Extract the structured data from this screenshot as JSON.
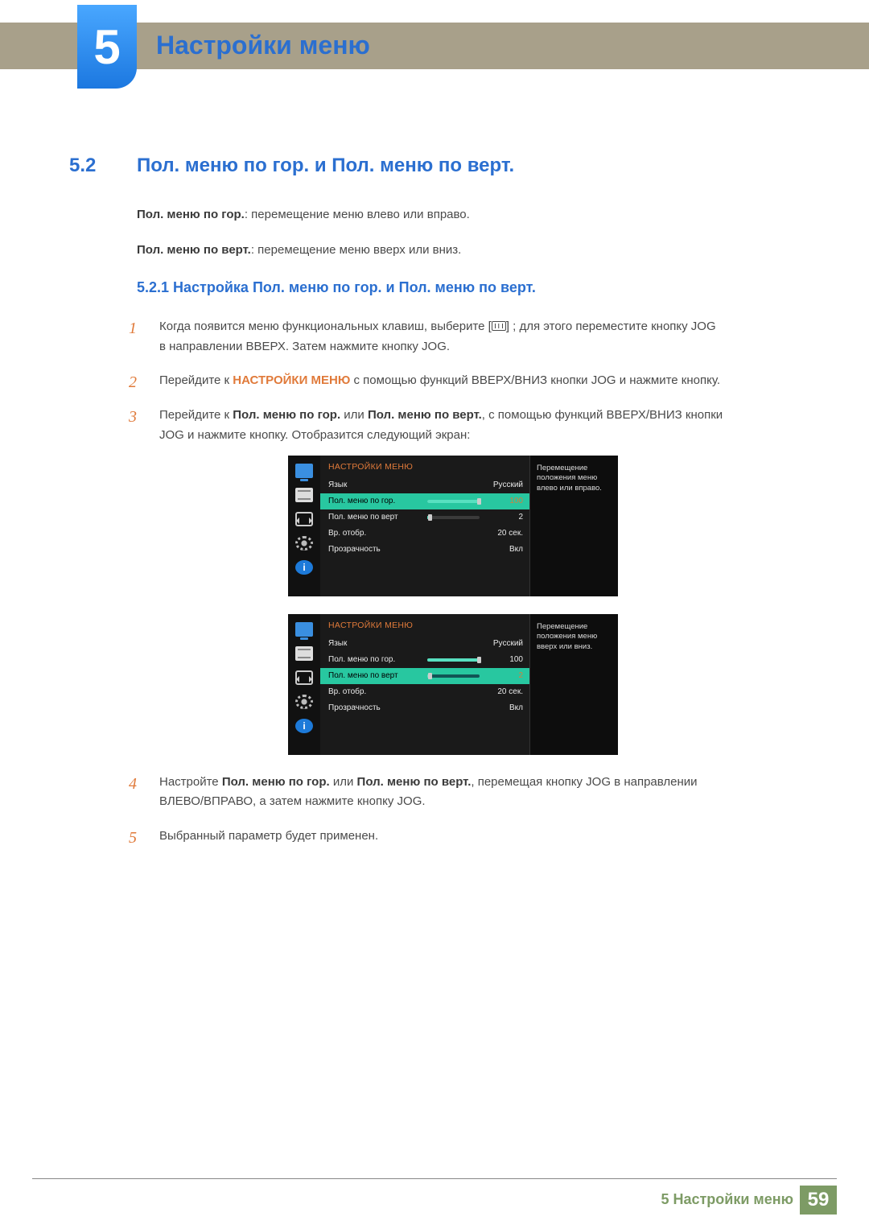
{
  "chapter": {
    "number": "5",
    "title": "Настройки меню"
  },
  "section": {
    "number": "5.2",
    "title": "Пол. меню по гор. и Пол. меню по верт."
  },
  "intro": {
    "l1_bold": "Пол. меню по гор.",
    "l1_rest": ": перемещение меню влево или вправо.",
    "l2_bold": "Пол. меню по верт.",
    "l2_rest": ": перемещение меню вверх или вниз."
  },
  "subheader": "5.2.1  Настройка Пол. меню по гор. и Пол. меню по верт.",
  "steps": {
    "s1a": "Когда появится меню функциональных клавиш, выберите [",
    "s1b": "] ; для этого переместите кнопку JOG в направлении ВВЕРХ. Затем нажмите кнопку JOG.",
    "s2a": "Перейдите к ",
    "s2b": "НАСТРОЙКИ МЕНЮ",
    "s2c": " с помощью функций ВВЕРХ/ВНИЗ кнопки JOG и нажмите кнопку.",
    "s3a": "Перейдите к ",
    "s3b": "Пол. меню по гор.",
    "s3c": " или ",
    "s3d": "Пол. меню по верт.",
    "s3e": ", с помощью функций ВВЕРХ/ВНИЗ кнопки JOG и нажмите кнопку. Отобразится следующий экран:",
    "s4a": "Настройте ",
    "s4b": "Пол. меню по гор.",
    "s4c": " или ",
    "s4d": "Пол. меню по верт.",
    "s4e": ", перемещая кнопку JOG в направлении ВЛЕВО/ВПРАВО, а затем нажмите кнопку JOG.",
    "s5": "Выбранный параметр будет применен."
  },
  "osd": {
    "title": "НАСТРОЙКИ МЕНЮ",
    "rows": {
      "lang_lbl": "Язык",
      "lang_val": "Русский",
      "h_lbl": "Пол. меню по гор.",
      "h_val": "100",
      "v_lbl": "Пол. меню по верт",
      "v_val": "2",
      "time_lbl": "Вр. отобр.",
      "time_val": "20 сек.",
      "trans_lbl": "Прозрачность",
      "trans_val": "Вкл"
    },
    "tip1": "Перемещение положения меню влево или вправо.",
    "tip2": "Перемещение положения меню вверх или вниз."
  },
  "footer": {
    "label": "5 Настройки меню",
    "page": "59"
  },
  "icons": {
    "info_glyph": "i"
  },
  "chart_data": {
    "type": "table",
    "title": "НАСТРОЙКИ МЕНЮ (OSD settings)",
    "rows": [
      {
        "label": "Язык",
        "value": "Русский"
      },
      {
        "label": "Пол. меню по гор.",
        "value": 100,
        "range": [
          0,
          100
        ]
      },
      {
        "label": "Пол. меню по верт",
        "value": 2,
        "range": [
          0,
          100
        ]
      },
      {
        "label": "Вр. отобр.",
        "value": "20 сек."
      },
      {
        "label": "Прозрачность",
        "value": "Вкл"
      }
    ]
  }
}
